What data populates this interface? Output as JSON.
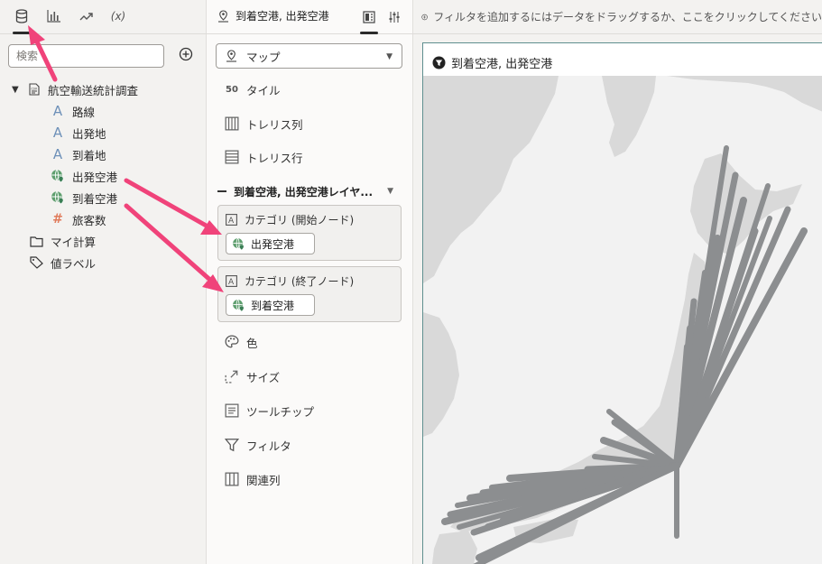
{
  "colors": {
    "accent": "#2b2b2b",
    "arrow": "#f0437a",
    "route": "#8c8e90",
    "land": "#d9d9d9",
    "globe_icon": "#3a7f55",
    "measure_icon": "#e07b5b"
  },
  "left_tabs": [
    {
      "name": "data-icon"
    },
    {
      "name": "bar-chart-icon"
    },
    {
      "name": "analytics-icon"
    },
    {
      "name": "calculation-icon",
      "label": "(x)"
    }
  ],
  "search": {
    "placeholder": "検索"
  },
  "tree": {
    "root": "航空輸送統計調査",
    "fields": [
      "路線",
      "出発地",
      "到着地",
      "出発空港",
      "到着空港",
      "旅客数"
    ],
    "my_calc": "マイ計算",
    "value_labels": "値ラベル"
  },
  "middle": {
    "title": "到着空港, 出発空港",
    "viz_type": "マップ",
    "grammar": {
      "tile": "タイル",
      "trellis_col": "トレリス列",
      "trellis_row": "トレリス行"
    },
    "layer": "到着空港, 出発空港レイヤ...",
    "start_node": {
      "title": "カテゴリ (開始ノード)",
      "pill": "出発空港"
    },
    "end_node": {
      "title": "カテゴリ (終了ノード)",
      "pill": "到着空港"
    },
    "encodings": {
      "color": "色",
      "size": "サイズ",
      "tooltip": "ツールチップ",
      "filter": "フィルタ",
      "related": "関連列"
    }
  },
  "filter_bar": {
    "text": "フィルタを追加するにはデータをドラッグするか、ここをクリックしてください"
  },
  "canvas": {
    "title": "到着空港, 出発空港"
  }
}
